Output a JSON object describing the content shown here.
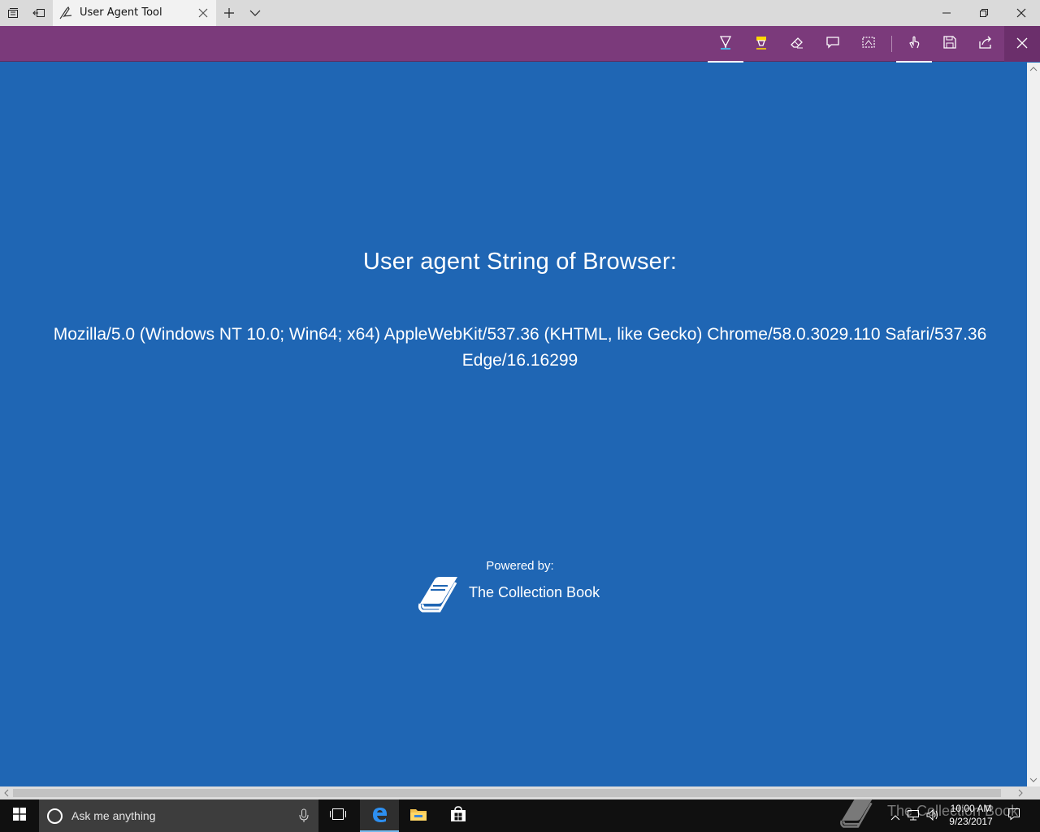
{
  "browser": {
    "tab_title": "User Agent Tool"
  },
  "page": {
    "heading": "User agent String of Browser:",
    "user_agent_line1": "Mozilla/5.0 (Windows NT 10.0; Win64; x64) AppleWebKit/537.36 (KHTML, like Gecko) Chrome/58.0.3029.110 Safari/537.36",
    "user_agent_line2": "Edge/16.16299",
    "powered_by": "Powered by:",
    "brand_name": "The Collection Book"
  },
  "taskbar": {
    "search_placeholder": "Ask me anything",
    "time": "10:00 AM",
    "date": "9/23/2017",
    "watermark": "The Collection Book"
  },
  "colors": {
    "page_bg": "#1f66b4",
    "ink_toolbar": "#7b3a7b",
    "taskbar": "#101010",
    "highlighter": "#ffd800",
    "pen_accent": "#3ad0ff"
  },
  "icons": {
    "tab_actions": [
      "tabs-aside-icon",
      "restore-tabs-icon"
    ],
    "ink_tools": [
      "ballpoint-pen-icon",
      "highlighter-icon",
      "eraser-icon",
      "add-note-icon",
      "clip-icon",
      "touch-writing-icon",
      "save-icon",
      "share-icon",
      "exit-icon"
    ]
  }
}
